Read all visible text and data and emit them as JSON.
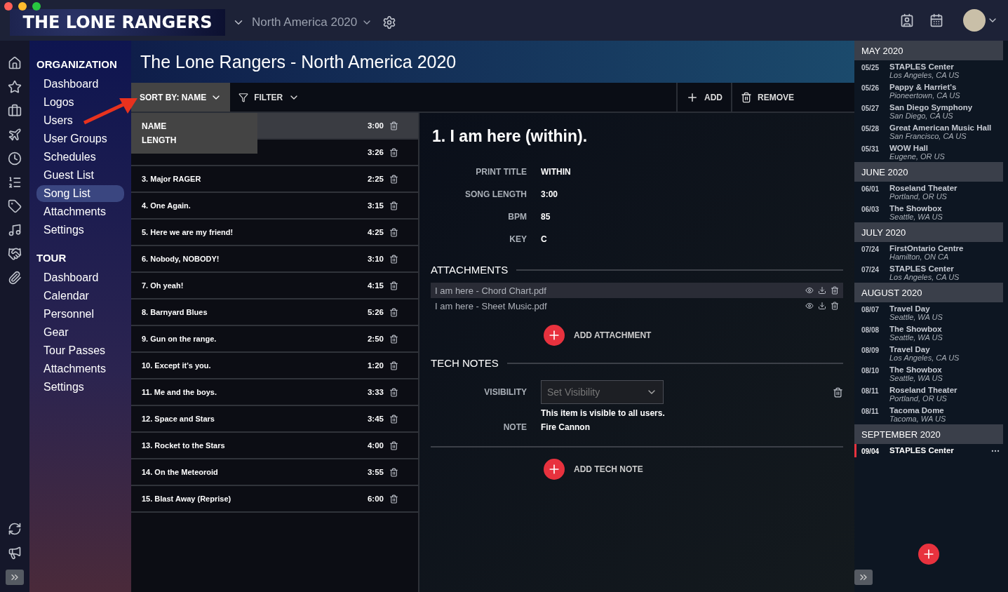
{
  "app": {
    "logo": "THE LONE RANGERS",
    "tour_selector": "North America 2020"
  },
  "nav": {
    "sections": [
      {
        "title": "ORGANIZATION",
        "items": [
          {
            "label": "Dashboard",
            "selected": false
          },
          {
            "label": "Logos",
            "selected": false
          },
          {
            "label": "Users",
            "selected": false
          },
          {
            "label": "User Groups",
            "selected": false
          },
          {
            "label": "Schedules",
            "selected": false
          },
          {
            "label": "Guest List",
            "selected": false
          },
          {
            "label": "Song List",
            "selected": true
          },
          {
            "label": "Attachments",
            "selected": false
          },
          {
            "label": "Settings",
            "selected": false
          }
        ]
      },
      {
        "title": "TOUR",
        "items": [
          {
            "label": "Dashboard",
            "selected": false
          },
          {
            "label": "Calendar",
            "selected": false
          },
          {
            "label": "Personnel",
            "selected": false
          },
          {
            "label": "Gear",
            "selected": false
          },
          {
            "label": "Tour Passes",
            "selected": false
          },
          {
            "label": "Attachments",
            "selected": false
          },
          {
            "label": "Settings",
            "selected": false
          }
        ]
      }
    ]
  },
  "page_title": "The Lone Rangers - North America 2020",
  "toolbar": {
    "sort_label": "SORT BY:",
    "sort_value": "NAME",
    "sort_expanded": true,
    "sort_options": [
      "NAME",
      "LENGTH"
    ],
    "filter": "FILTER",
    "add": "ADD",
    "remove": "REMOVE"
  },
  "songs": [
    {
      "length": "3:00",
      "selected": true
    },
    {
      "length": "3:26",
      "selected": false
    },
    {
      "title": "3. Major RAGER",
      "length": "2:25",
      "selected": false
    },
    {
      "title": "4. One Again.",
      "length": "3:15",
      "selected": false
    },
    {
      "title": "5. Here we are my friend!",
      "length": "4:25",
      "selected": false
    },
    {
      "title": "6. Nobody, NOBODY!",
      "length": "3:10",
      "selected": false
    },
    {
      "title": "7. Oh yeah!",
      "length": "4:15",
      "selected": false
    },
    {
      "title": "8. Barnyard Blues",
      "length": "5:26",
      "selected": false
    },
    {
      "title": "9. Gun on the range.",
      "length": "2:50",
      "selected": false
    },
    {
      "title": "10. Except it's you.",
      "length": "1:20",
      "selected": false
    },
    {
      "title": "11. Me and the boys.",
      "length": "3:33",
      "selected": false
    },
    {
      "title": "12. Space and Stars",
      "length": "3:45",
      "selected": false
    },
    {
      "title": "13. Rocket to the Stars",
      "length": "4:00",
      "selected": false
    },
    {
      "title": "14. On the Meteoroid",
      "length": "3:55",
      "selected": false
    },
    {
      "title": "15. Blast Away (Reprise)",
      "length": "6:00",
      "selected": false
    }
  ],
  "detail": {
    "title": "1. I am here (within).",
    "fields": [
      {
        "label": "PRINT TITLE",
        "value": "WITHIN"
      },
      {
        "label": "SONG LENGTH",
        "value": "3:00"
      },
      {
        "label": "BPM",
        "value": "85"
      },
      {
        "label": "KEY",
        "value": "C"
      }
    ],
    "attachments_heading": "ATTACHMENTS",
    "attachments": [
      {
        "name": "I am here - Chord Chart.pdf",
        "selected": true
      },
      {
        "name": "I am here - Sheet Music.pdf",
        "selected": false
      }
    ],
    "add_attachment": "ADD ATTACHMENT",
    "tech_notes_heading": "TECH NOTES",
    "visibility_label": "VISIBILITY",
    "visibility_placeholder": "Set Visibility",
    "visibility_hint": "This item is visible to all users.",
    "note_label": "NOTE",
    "note_value": "Fire Cannon",
    "add_tech_note": "ADD TECH NOTE"
  },
  "schedule": {
    "months": [
      {
        "label": "MAY 2020",
        "events": [
          {
            "date": "05/25",
            "venue": "STAPLES Center",
            "location": "Los Angeles, CA US",
            "selected": false
          },
          {
            "date": "05/26",
            "venue": "Pappy & Harriet's",
            "location": "Pioneertown, CA US",
            "selected": false
          },
          {
            "date": "05/27",
            "venue": "San Diego Symphony",
            "location": "San Diego, CA US",
            "selected": false
          },
          {
            "date": "05/28",
            "venue": "Great American Music Hall",
            "location": "San Francisco, CA US",
            "selected": false
          },
          {
            "date": "05/31",
            "venue": "WOW Hall",
            "location": "Eugene, OR US",
            "selected": false
          }
        ]
      },
      {
        "label": "JUNE 2020",
        "events": [
          {
            "date": "06/01",
            "venue": "Roseland Theater",
            "location": "Portland, OR US",
            "selected": false
          },
          {
            "date": "06/03",
            "venue": "The Showbox",
            "location": "Seattle, WA US",
            "selected": false
          }
        ]
      },
      {
        "label": "JULY 2020",
        "events": [
          {
            "date": "07/24",
            "venue": "FirstOntario Centre",
            "location": "Hamilton, ON CA",
            "selected": false
          },
          {
            "date": "07/24",
            "venue": "STAPLES Center",
            "location": "Los Angeles, CA US",
            "selected": false
          }
        ]
      },
      {
        "label": "AUGUST 2020",
        "events": [
          {
            "date": "08/07",
            "venue": "Travel Day",
            "location": "Seattle, WA US",
            "selected": false
          },
          {
            "date": "08/08",
            "venue": "The Showbox",
            "location": "Seattle, WA US",
            "selected": false
          },
          {
            "date": "08/09",
            "venue": "Travel Day",
            "location": "Los Angeles, CA US",
            "selected": false
          },
          {
            "date": "08/10",
            "venue": "The Showbox",
            "location": "Seattle, WA US",
            "selected": false
          },
          {
            "date": "08/11",
            "venue": "Roseland Theater",
            "location": "Portland, OR US",
            "selected": false
          },
          {
            "date": "08/11",
            "venue": "Tacoma Dome",
            "location": "Tacoma, WA US",
            "selected": false
          }
        ]
      },
      {
        "label": "SEPTEMBER 2020",
        "events": [
          {
            "date": "09/04",
            "venue": "STAPLES Center",
            "selected": true
          }
        ]
      }
    ]
  }
}
